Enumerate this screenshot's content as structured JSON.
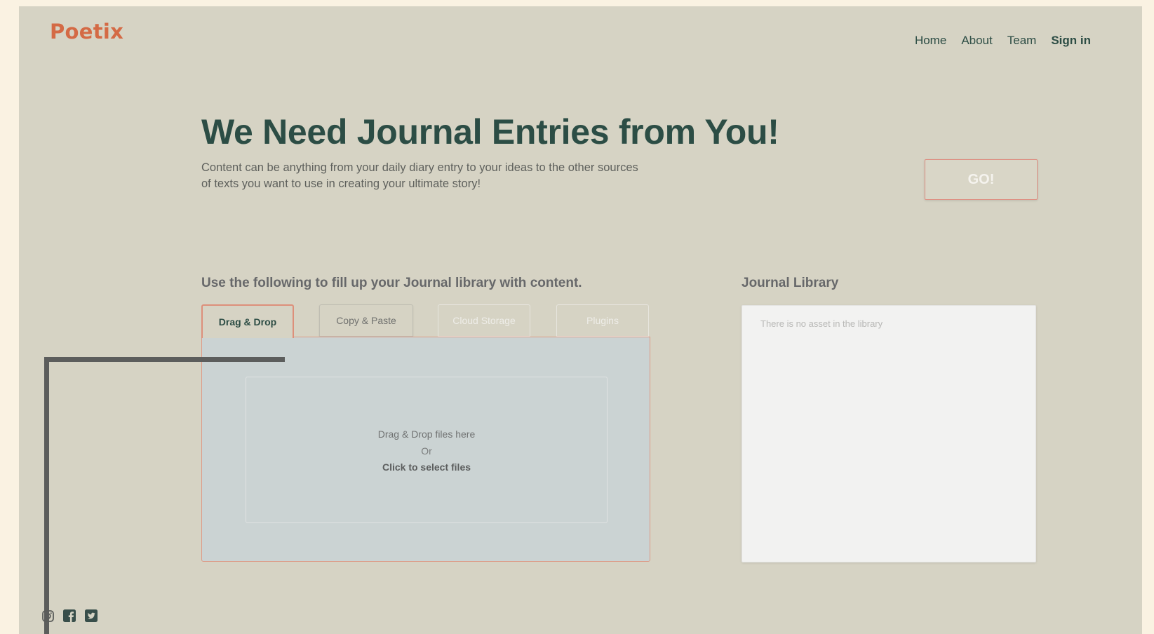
{
  "brand": {
    "logo": "Poetix",
    "logo_color": "#d46a45"
  },
  "nav": {
    "items": [
      {
        "label": "Home"
      },
      {
        "label": "About"
      },
      {
        "label": "Team"
      },
      {
        "label": "Sign in"
      }
    ]
  },
  "hero": {
    "title": "We Need Journal Entries from You!",
    "subtitle": "Content can be anything from your daily diary entry to your ideas to the other sources of texts you want to use in creating your ultimate story!",
    "go_label": "GO!"
  },
  "uploader": {
    "heading": "Use the following to fill up your Journal library with content.",
    "tabs": [
      {
        "label": "Drag & Drop",
        "active": true
      },
      {
        "label": "Copy & Paste",
        "active": false
      },
      {
        "label": "Cloud Storage",
        "active": false
      },
      {
        "label": "Plugins",
        "active": false
      }
    ],
    "dropzone": {
      "line1": "Drag & Drop files here",
      "line2": "Or",
      "line3": "Click to select files"
    }
  },
  "library": {
    "heading": "Journal Library",
    "empty_text": "There is no asset in the library"
  },
  "social": {
    "icons": [
      "instagram-icon",
      "facebook-icon",
      "twitter-icon"
    ]
  },
  "colors": {
    "background_outer": "#faf2e2",
    "background_page": "#d6d3c4",
    "title": "#2c4d45",
    "accent_border": "#dd8f7a",
    "drop_panel": "#cbd3d3",
    "library_panel": "#f2f2f1"
  }
}
